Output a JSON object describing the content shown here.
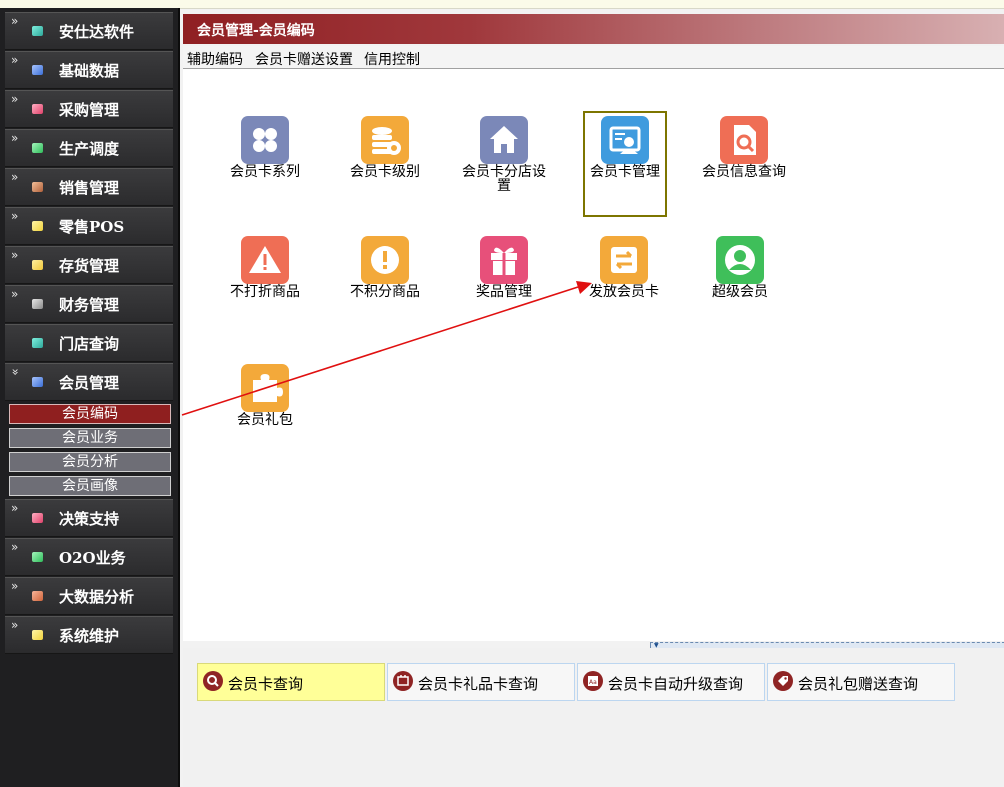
{
  "sidebar": {
    "items": [
      {
        "label": "安仕达软件",
        "icon": "teal-cube-icon",
        "color": "#2ea89a"
      },
      {
        "label": "基础数据",
        "icon": "blue-cube-icon",
        "color": "#3b6fd6"
      },
      {
        "label": "采购管理",
        "icon": "pink-cube-icon",
        "color": "#e0416a"
      },
      {
        "label": "生产调度",
        "icon": "green-cube-icon",
        "color": "#2fbd5a"
      },
      {
        "label": "销售管理",
        "icon": "brown-cube-icon",
        "color": "#b0603a"
      },
      {
        "label": "零售POS",
        "icon": "yellow-cube-icon",
        "color": "#f0d23c"
      },
      {
        "label": "存货管理",
        "icon": "yellow-cube-icon",
        "color": "#f0c73a"
      },
      {
        "label": "财务管理",
        "icon": "gray-cube-icon",
        "color": "#9a9a9a"
      },
      {
        "label": "门店查询",
        "icon": "teal-cube-icon",
        "color": "#2ea89a"
      },
      {
        "label": "会员管理",
        "icon": "blue-cube-icon",
        "color": "#3b6fd6"
      },
      {
        "label": "决策支持",
        "icon": "pink-cube-icon",
        "color": "#e0416a"
      },
      {
        "label": "O2O业务",
        "icon": "green-cube-icon",
        "color": "#2fbd5a"
      },
      {
        "label": "大数据分析",
        "icon": "orange-cube-icon",
        "color": "#d0643a"
      },
      {
        "label": "系统维护",
        "icon": "yellow-cube-icon",
        "color": "#f0d23c"
      }
    ],
    "subitems": [
      {
        "label": "会员编码",
        "active": true
      },
      {
        "label": "会员业务",
        "active": false
      },
      {
        "label": "会员分析",
        "active": false
      },
      {
        "label": "会员画像",
        "active": false
      }
    ]
  },
  "header": {
    "title": "会员管理-会员编码"
  },
  "toolbar": {
    "items": [
      "辅助编码",
      "会员卡赠送设置",
      "信用控制"
    ]
  },
  "tiles": [
    {
      "label": "会员卡系列",
      "icon": "grid-icon",
      "color": "#7b88b8"
    },
    {
      "label": "会员卡级别",
      "icon": "coins-icon",
      "color": "#f3a93a"
    },
    {
      "label": "会员卡分店设置",
      "icon": "home-icon",
      "color": "#7b88b8"
    },
    {
      "label": "会员卡管理",
      "icon": "card-user-icon",
      "color": "#3f9bde"
    },
    {
      "label": "会员信息查询",
      "icon": "doc-search-icon",
      "color": "#ef6e55"
    },
    {
      "label": "不打折商品",
      "icon": "warning-icon",
      "color": "#ef6e55"
    },
    {
      "label": "不积分商品",
      "icon": "exclamation-icon",
      "color": "#f3a93a"
    },
    {
      "label": "奖品管理",
      "icon": "gift-icon",
      "color": "#e7507a"
    },
    {
      "label": "发放会员卡",
      "icon": "exchange-icon",
      "color": "#f3a93a"
    },
    {
      "label": "超级会员",
      "icon": "user-icon",
      "color": "#3fbf5a"
    },
    {
      "label": "会员礼包",
      "icon": "puzzle-icon",
      "color": "#f3a93a"
    }
  ],
  "queries": [
    {
      "label": "会员卡查询",
      "icon": "search-icon"
    },
    {
      "label": "会员卡礼品卡查询",
      "icon": "gift-card-icon"
    },
    {
      "label": "会员卡自动升级查询",
      "icon": "upgrade-icon"
    },
    {
      "label": "会员礼包赠送查询",
      "icon": "tag-icon"
    }
  ]
}
